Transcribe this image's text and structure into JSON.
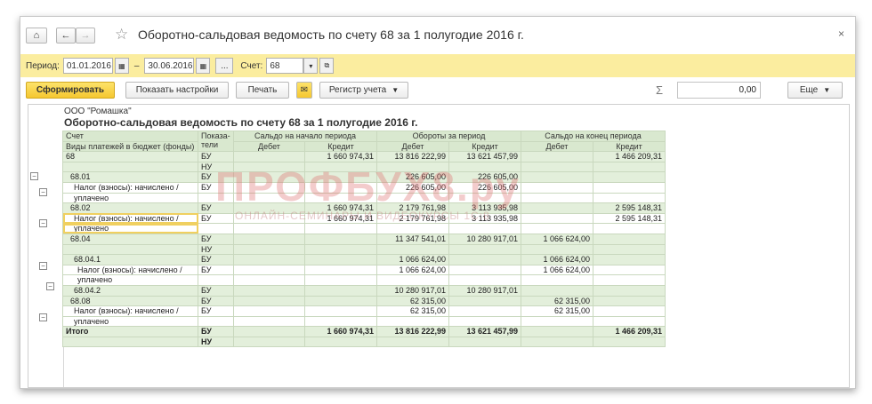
{
  "window": {
    "title": "Оборотно-сальдовая ведомость по счету 68 за 1 полугодие 2016 г.",
    "close": "×"
  },
  "period": {
    "label": "Период:",
    "from": "01.01.2016",
    "dash": "–",
    "to": "30.06.2016",
    "more": "...",
    "account_label": "Счет:",
    "account": "68"
  },
  "toolbar": {
    "generate": "Сформировать",
    "settings": "Показать настройки",
    "print": "Печать",
    "register": "Регистр учета",
    "sigma": "Σ",
    "sum": "0,00",
    "more": "Еще"
  },
  "report": {
    "org": "ООО \"Ромашка\"",
    "title": "Оборотно-сальдовая ведомость по счету 68 за 1 полугодие 2016 г.",
    "headers": {
      "account": "Счет",
      "indicators": "Показа-\nтели",
      "opening": "Сальдо на начало периода",
      "turnover": "Обороты за период",
      "closing": "Сальдо на конец периода",
      "debit": "Дебет",
      "credit": "Кредит",
      "subconto": "Виды платежей в бюджет (фонды)"
    },
    "rows": [
      {
        "name": "68",
        "ind": "БУ",
        "od": "",
        "oc": "1 660 974,31",
        "td": "13 816 222,99",
        "tc": "13 621 457,99",
        "cd": "",
        "cc": "1 466 209,31",
        "style": "g",
        "level": 0
      },
      {
        "name": "",
        "ind": "НУ",
        "od": "",
        "oc": "",
        "td": "",
        "tc": "",
        "cd": "",
        "cc": "",
        "style": "g",
        "level": 0
      },
      {
        "name": "68.01",
        "ind": "БУ",
        "od": "",
        "oc": "",
        "td": "226 605,00",
        "tc": "226 605,00",
        "cd": "",
        "cc": "",
        "style": "g",
        "level": 1
      },
      {
        "name": "Налог (взносы): начислено /",
        "ind": "БУ",
        "od": "",
        "oc": "",
        "td": "226 605,00",
        "tc": "226 605,00",
        "cd": "",
        "cc": "",
        "style": "w",
        "level": 2
      },
      {
        "name": "уплачено",
        "ind": "",
        "od": "",
        "oc": "",
        "td": "",
        "tc": "",
        "cd": "",
        "cc": "",
        "style": "w",
        "level": 2
      },
      {
        "name": "68.02",
        "ind": "БУ",
        "od": "",
        "oc": "1 660 974,31",
        "td": "2 179 761,98",
        "tc": "3 113 935,98",
        "cd": "",
        "cc": "2 595 148,31",
        "style": "g",
        "level": 1
      },
      {
        "name": "Налог (взносы): начислено /",
        "ind": "БУ",
        "od": "",
        "oc": "1 660 974,31",
        "td": "2 179 761,98",
        "tc": "3 113 935,98",
        "cd": "",
        "cc": "2 595 148,31",
        "style": "w",
        "level": 2
      },
      {
        "name": "уплачено",
        "ind": "",
        "od": "",
        "oc": "",
        "td": "",
        "tc": "",
        "cd": "",
        "cc": "",
        "style": "w",
        "level": 2
      },
      {
        "name": "68.04",
        "ind": "БУ",
        "od": "",
        "oc": "",
        "td": "11 347 541,01",
        "tc": "10 280 917,01",
        "cd": "1 066 624,00",
        "cc": "",
        "style": "g",
        "level": 1
      },
      {
        "name": "",
        "ind": "НУ",
        "od": "",
        "oc": "",
        "td": "",
        "tc": "",
        "cd": "",
        "cc": "",
        "style": "g",
        "level": 1
      },
      {
        "name": "68.04.1",
        "ind": "БУ",
        "od": "",
        "oc": "",
        "td": "1 066 624,00",
        "tc": "",
        "cd": "1 066 624,00",
        "cc": "",
        "style": "g",
        "level": 2
      },
      {
        "name": "Налог (взносы): начислено /",
        "ind": "БУ",
        "od": "",
        "oc": "",
        "td": "1 066 624,00",
        "tc": "",
        "cd": "1 066 624,00",
        "cc": "",
        "style": "w",
        "level": 3
      },
      {
        "name": "уплачено",
        "ind": "",
        "od": "",
        "oc": "",
        "td": "",
        "tc": "",
        "cd": "",
        "cc": "",
        "style": "w",
        "level": 3
      },
      {
        "name": "68.04.2",
        "ind": "БУ",
        "od": "",
        "oc": "",
        "td": "10 280 917,01",
        "tc": "10 280 917,01",
        "cd": "",
        "cc": "",
        "style": "g",
        "level": 2
      },
      {
        "name": "68.08",
        "ind": "БУ",
        "od": "",
        "oc": "",
        "td": "62 315,00",
        "tc": "",
        "cd": "62 315,00",
        "cc": "",
        "style": "g",
        "level": 1
      },
      {
        "name": "Налог (взносы): начислено /",
        "ind": "БУ",
        "od": "",
        "oc": "",
        "td": "62 315,00",
        "tc": "",
        "cd": "62 315,00",
        "cc": "",
        "style": "w",
        "level": 2
      },
      {
        "name": "уплачено",
        "ind": "",
        "od": "",
        "oc": "",
        "td": "",
        "tc": "",
        "cd": "",
        "cc": "",
        "style": "w",
        "level": 2
      },
      {
        "name": "Итого",
        "ind": "БУ",
        "od": "",
        "oc": "1 660 974,31",
        "td": "13 816 222,99",
        "tc": "13 621 457,99",
        "cd": "",
        "cc": "1 466 209,31",
        "style": "tot",
        "level": 0
      },
      {
        "name": "",
        "ind": "НУ",
        "od": "",
        "oc": "",
        "td": "",
        "tc": "",
        "cd": "",
        "cc": "",
        "style": "tot",
        "level": 0
      }
    ]
  },
  "watermark": {
    "main": "ПРОФБУХ8.ру",
    "sub": "ОНЛАЙН-СЕМИНАРЫ И ВИДЕОКУРСЫ 1С:8"
  }
}
